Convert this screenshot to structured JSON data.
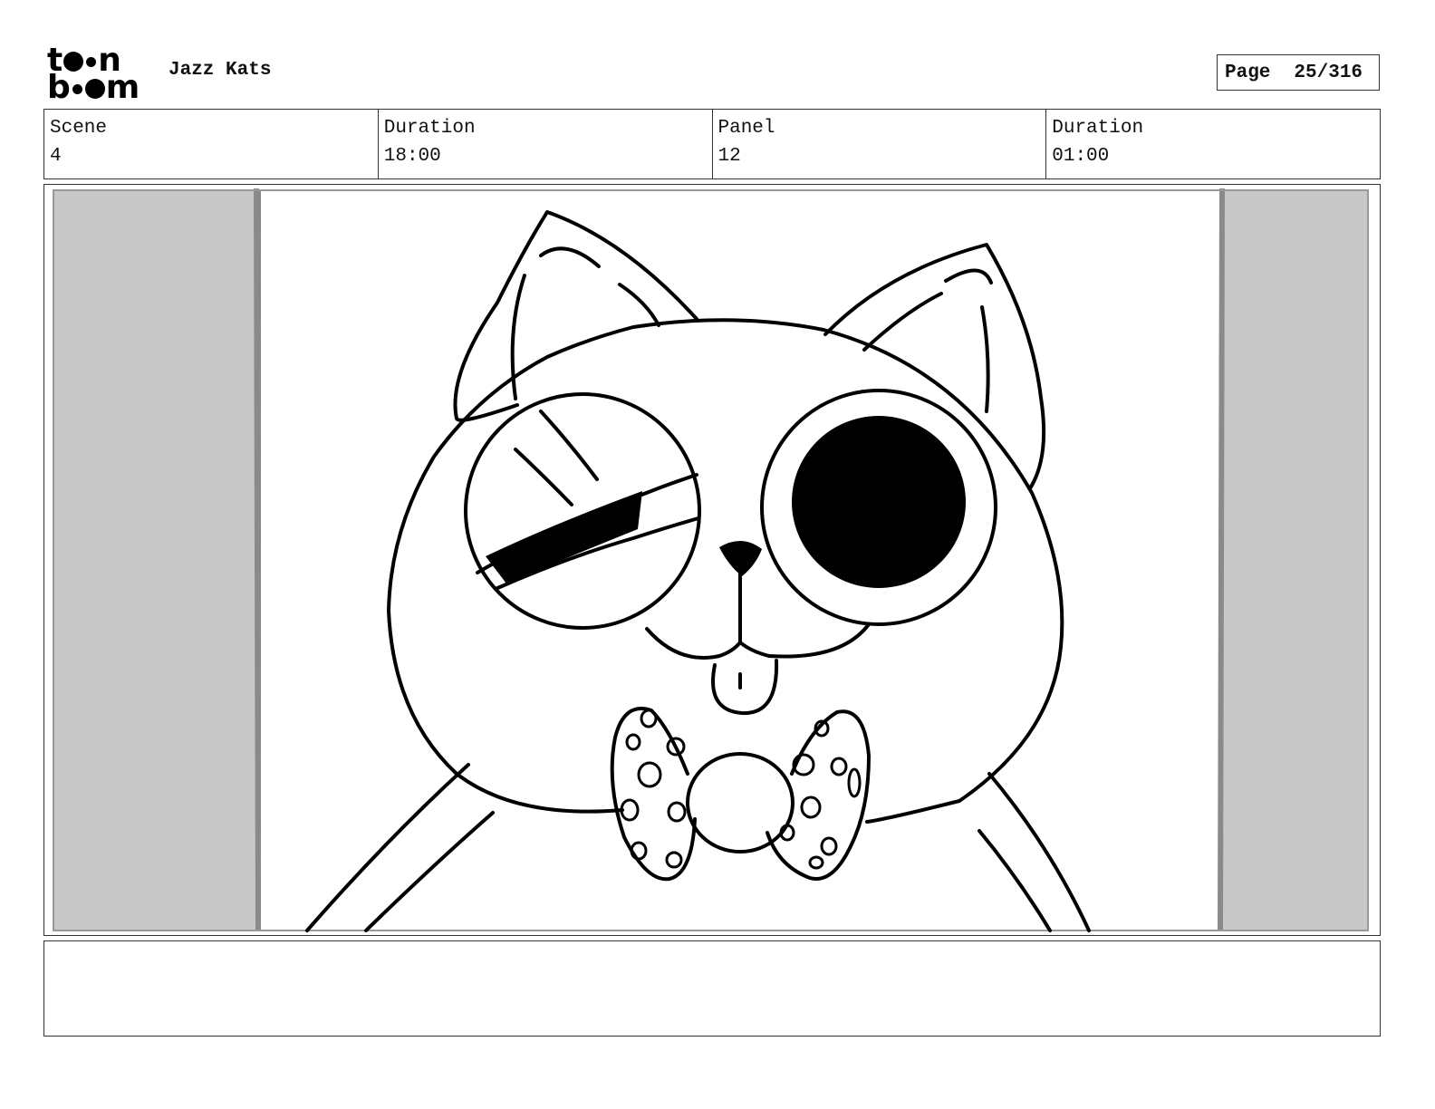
{
  "header": {
    "logo_line1": "toon",
    "logo_line2": "boom",
    "project_title": "Jazz Kats",
    "page_label": "Page",
    "page_value": "25/316"
  },
  "info": {
    "scene_label": "Scene",
    "scene_value": "4",
    "scene_duration_label": "Duration",
    "scene_duration_value": "18:00",
    "panel_label": "Panel",
    "panel_value": "12",
    "panel_duration_label": "Duration",
    "panel_duration_value": "01:00"
  },
  "panel_image": {
    "subject": "cat-with-bowtie-winking",
    "colors": {
      "line": "#000000",
      "mask": "#c8c8c8",
      "paper": "#ffffff"
    }
  },
  "notes": {
    "text": ""
  }
}
